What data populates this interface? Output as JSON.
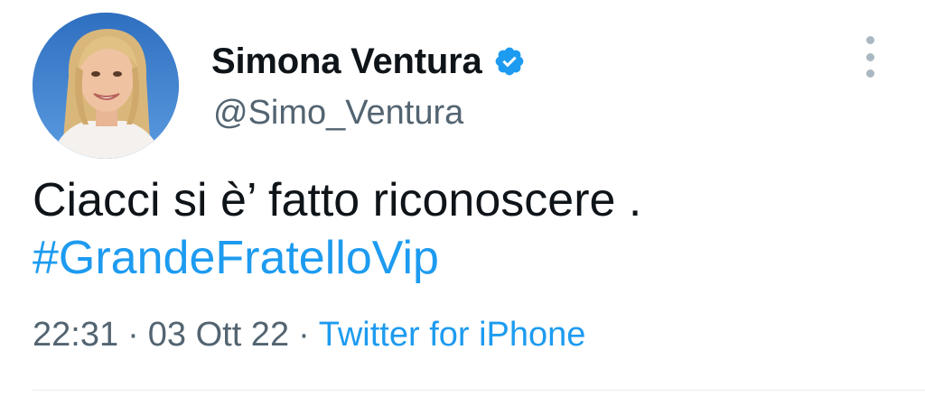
{
  "author": {
    "display_name": "Simona Ventura",
    "handle": "@Simo_Ventura",
    "verified": true
  },
  "tweet": {
    "text_line": "Ciacci si è’ fatto riconoscere .",
    "hashtag": "#GrandeFratelloVip"
  },
  "meta": {
    "time": "22:31",
    "date": "03 Ott 22",
    "separator": "·",
    "source": "Twitter for iPhone"
  },
  "icons": {
    "verified": "verified-badge-icon",
    "more": "more-vertical-icon"
  },
  "colors": {
    "link": "#1d9bf0",
    "secondary_text": "#536471",
    "primary_text": "#0f1419"
  }
}
